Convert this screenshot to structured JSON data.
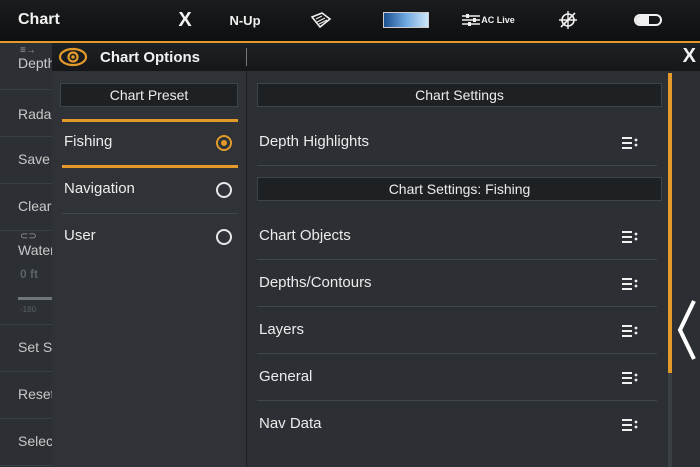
{
  "topbar": {
    "title": "Chart",
    "close_label": "X",
    "orientation": "N-Up",
    "aclive_label": "AC Live",
    "battery_level": 0.55,
    "accent_color": "#e39a2a"
  },
  "left_menu": {
    "items": [
      {
        "label": "Depth"
      },
      {
        "label": "Radar"
      },
      {
        "label": "Save"
      },
      {
        "label": "Clear"
      },
      {
        "label": "Water"
      },
      {
        "label": "Set S"
      },
      {
        "label": "Reset"
      },
      {
        "label": "Select"
      }
    ],
    "water_value": "0 ft",
    "water_scale": "-180"
  },
  "dialog": {
    "title": "Chart Options",
    "close_label": "X",
    "preset_header": "Chart Preset",
    "presets": [
      {
        "label": "Fishing",
        "selected": true
      },
      {
        "label": "Navigation",
        "selected": false
      },
      {
        "label": "User",
        "selected": false
      }
    ],
    "settings_header": "Chart Settings",
    "depth_highlights": "Depth Highlights",
    "fishing_header": "Chart Settings: Fishing",
    "fishing_items": [
      {
        "label": "Chart Objects"
      },
      {
        "label": "Depths/Contours"
      },
      {
        "label": "Layers"
      },
      {
        "label": "General"
      },
      {
        "label": "Nav Data"
      }
    ]
  }
}
